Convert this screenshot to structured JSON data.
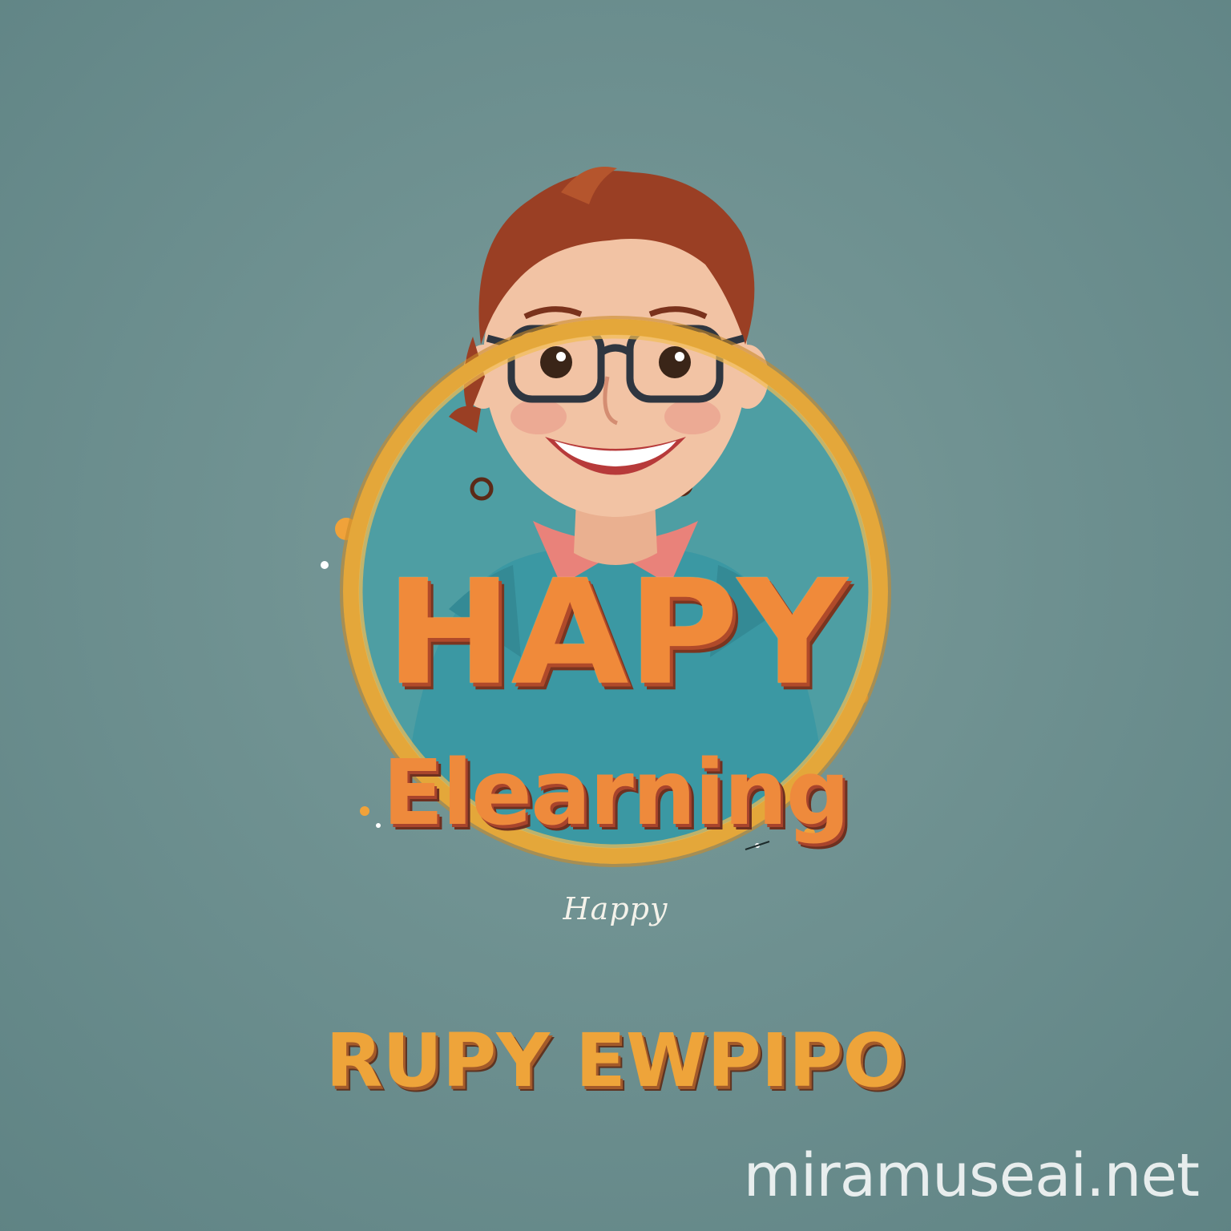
{
  "logo": {
    "title_main": "HAPY",
    "title_sub": "Elearning",
    "signature": "Happy",
    "tagline": "RUPY EWPIPO"
  },
  "watermark": "miramuseai.net",
  "colors": {
    "background": "#6f9191",
    "ring": "#e4a73a",
    "circle_fill": "#4e9ea3",
    "shirt": "#3b98a3",
    "collar": "#e9827a",
    "hair": "#9a3f24",
    "skin": "#f2c3a4",
    "title_orange": "#f08a3a"
  }
}
